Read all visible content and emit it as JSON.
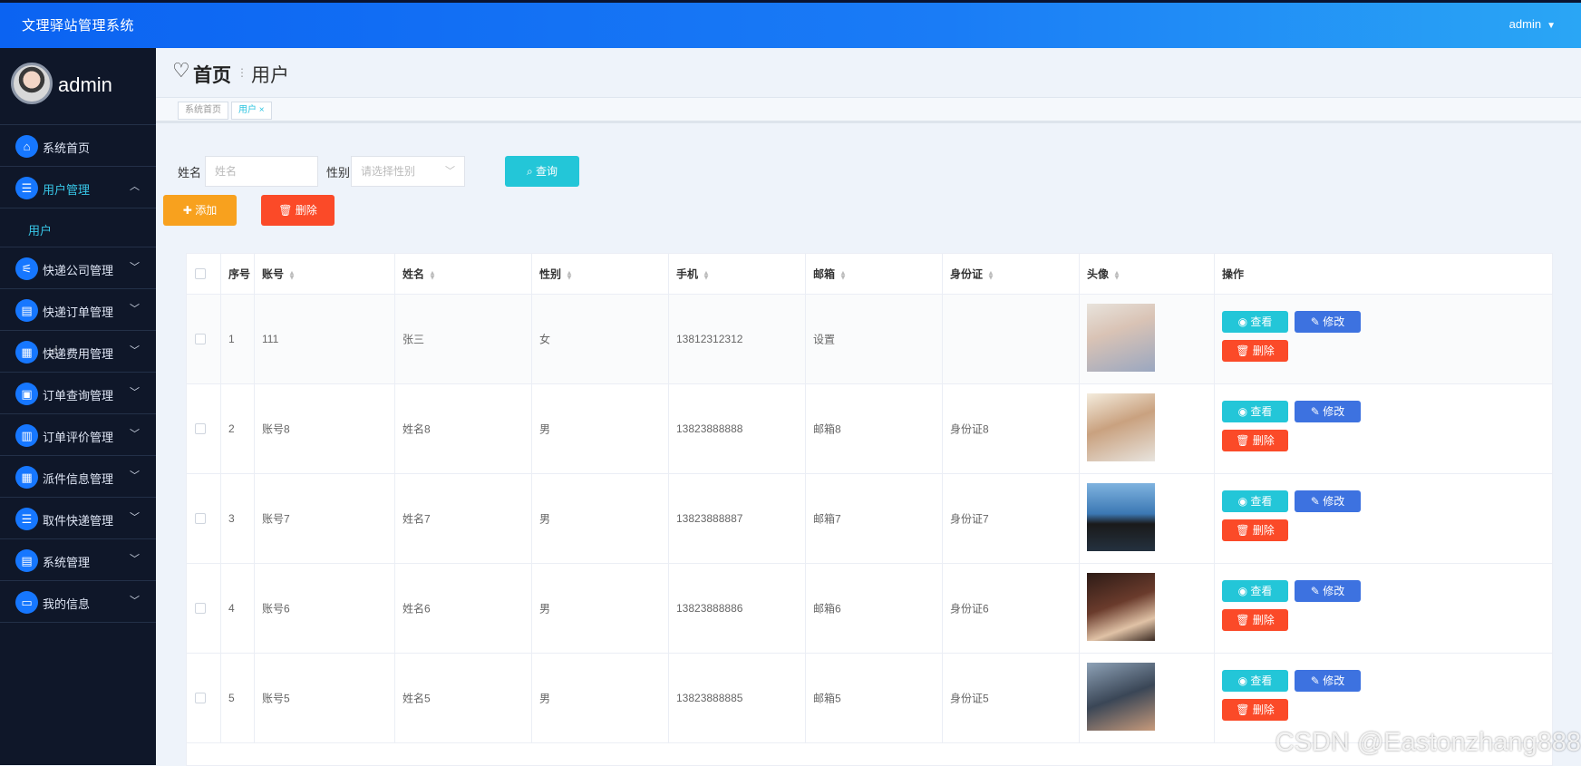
{
  "header": {
    "app_title": "文理驿站管理系统",
    "user_name": "admin"
  },
  "sidebar": {
    "profile_name": "admin",
    "items": [
      {
        "label": "系统首页",
        "icon": "home-icon"
      },
      {
        "label": "用户管理",
        "icon": "list-icon",
        "expanded": true
      },
      {
        "label": "快递公司管理",
        "icon": "sliders-icon"
      },
      {
        "label": "快递订单管理",
        "icon": "clipboard-icon"
      },
      {
        "label": "快递费用管理",
        "icon": "grid-icon"
      },
      {
        "label": "订单查询管理",
        "icon": "briefcase-icon"
      },
      {
        "label": "订单评价管理",
        "icon": "book-icon"
      },
      {
        "label": "派件信息管理",
        "icon": "grid-icon"
      },
      {
        "label": "取件快递管理",
        "icon": "list-icon"
      },
      {
        "label": "系统管理",
        "icon": "clipboard-icon"
      },
      {
        "label": "我的信息",
        "icon": "card-icon"
      }
    ],
    "sub_item": "用户"
  },
  "breadcrumb": {
    "home": "首页",
    "current": "用户"
  },
  "tags": {
    "home": "系统首页",
    "current": "用户"
  },
  "filter": {
    "name_label": "姓名",
    "name_placeholder": "姓名",
    "gender_label": "性别",
    "gender_placeholder": "请选择性别",
    "query_button": "查询"
  },
  "actions": {
    "add": "添加",
    "delete": "删除"
  },
  "table": {
    "columns": [
      "序号",
      "账号",
      "姓名",
      "性别",
      "手机",
      "邮箱",
      "身份证",
      "头像",
      "操作"
    ],
    "row_actions": {
      "view": "查看",
      "edit": "修改",
      "delete": "删除"
    },
    "rows": [
      {
        "no": "1",
        "account": "111",
        "name": "张三",
        "gender": "女",
        "phone": "13812312312",
        "email": "设置",
        "id_card": ""
      },
      {
        "no": "2",
        "account": "账号8",
        "name": "姓名8",
        "gender": "男",
        "phone": "13823888888",
        "email": "邮箱8",
        "id_card": "身份证8"
      },
      {
        "no": "3",
        "account": "账号7",
        "name": "姓名7",
        "gender": "男",
        "phone": "13823888887",
        "email": "邮箱7",
        "id_card": "身份证7"
      },
      {
        "no": "4",
        "account": "账号6",
        "name": "姓名6",
        "gender": "男",
        "phone": "13823888886",
        "email": "邮箱6",
        "id_card": "身份证6"
      },
      {
        "no": "5",
        "account": "账号5",
        "name": "姓名5",
        "gender": "男",
        "phone": "13823888885",
        "email": "邮箱5",
        "id_card": "身份证5"
      }
    ]
  },
  "watermark": "CSDN @Eastonzhang888"
}
